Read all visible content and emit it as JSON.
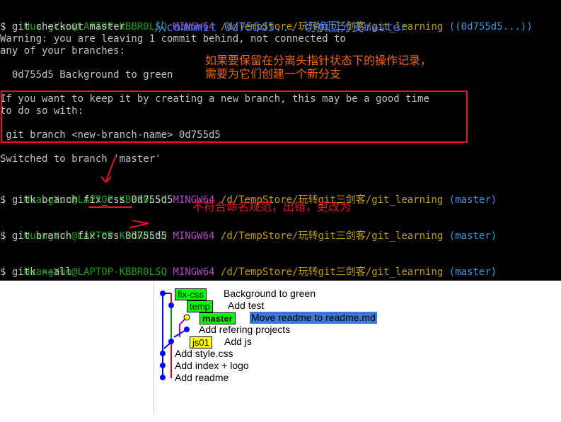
{
  "terminal": {
    "prompt": {
      "user": "HuangYun@LAPTOP-KBBR0LSQ",
      "shell": "MINGW64",
      "path": "/d/TempStore/玩转git三剑客/git_learning",
      "detached_branch": "((0d755d5...))",
      "master_branch": "(master)"
    },
    "lines": {
      "cmd1": "$ git checkout master",
      "warn1": "Warning: you are leaving 1 commit behind, not connected to",
      "warn2": "any of your branches:",
      "commit_line": "  0d755d5 Background to green",
      "box1": "If you want to keep it by creating a new branch, this may be a good time",
      "box2": "to do so with:",
      "box3": " git branch <new-branch-name> 0d755d5",
      "switched": "Switched to branch 'master'",
      "cmd2_prefix": "$ gitk branch ",
      "cmd2_name": "fix_css",
      "cmd2_suffix": " 0d755d5",
      "cmd3": "$ git branch fix-css 0d755d5",
      "cmd4": "$ gitk --all"
    },
    "annotations": {
      "checkout_note": "从commmit 0d755d5... 切换回分支master",
      "keep_note_1": "如果要保留在分离头指针状态下的操作记录，",
      "keep_note_2": "需要为它们创建一个新分支",
      "naming_note": "不符合命名规范，出错，更改为"
    }
  },
  "gitk": {
    "commits": [
      {
        "refs": [
          {
            "label": "fix-css",
            "color": "green",
            "bold": false
          }
        ],
        "message": "Background to green",
        "selected": false
      },
      {
        "refs": [
          {
            "label": "temp",
            "color": "green",
            "bold": false
          }
        ],
        "message": "Add test",
        "selected": false
      },
      {
        "refs": [
          {
            "label": "master",
            "color": "green",
            "bold": true
          }
        ],
        "message": "Move readme to readme.md",
        "selected": true
      },
      {
        "refs": [],
        "message": "Add refering projects",
        "selected": false
      },
      {
        "refs": [
          {
            "label": "js01",
            "color": "yellow",
            "bold": false
          }
        ],
        "message": "Add js",
        "selected": false
      },
      {
        "refs": [],
        "message": "Add style.css",
        "selected": false
      },
      {
        "refs": [],
        "message": "Add index + logo",
        "selected": false
      },
      {
        "refs": [],
        "message": "Add readme",
        "selected": false
      }
    ],
    "colors": {
      "graph_blue": "#0000ff",
      "graph_red": "#ff0000",
      "graph_magenta": "#c000c0",
      "graph_green": "#00a000",
      "head_yellow": "#ffff00",
      "selection": "#3b78d8"
    }
  }
}
